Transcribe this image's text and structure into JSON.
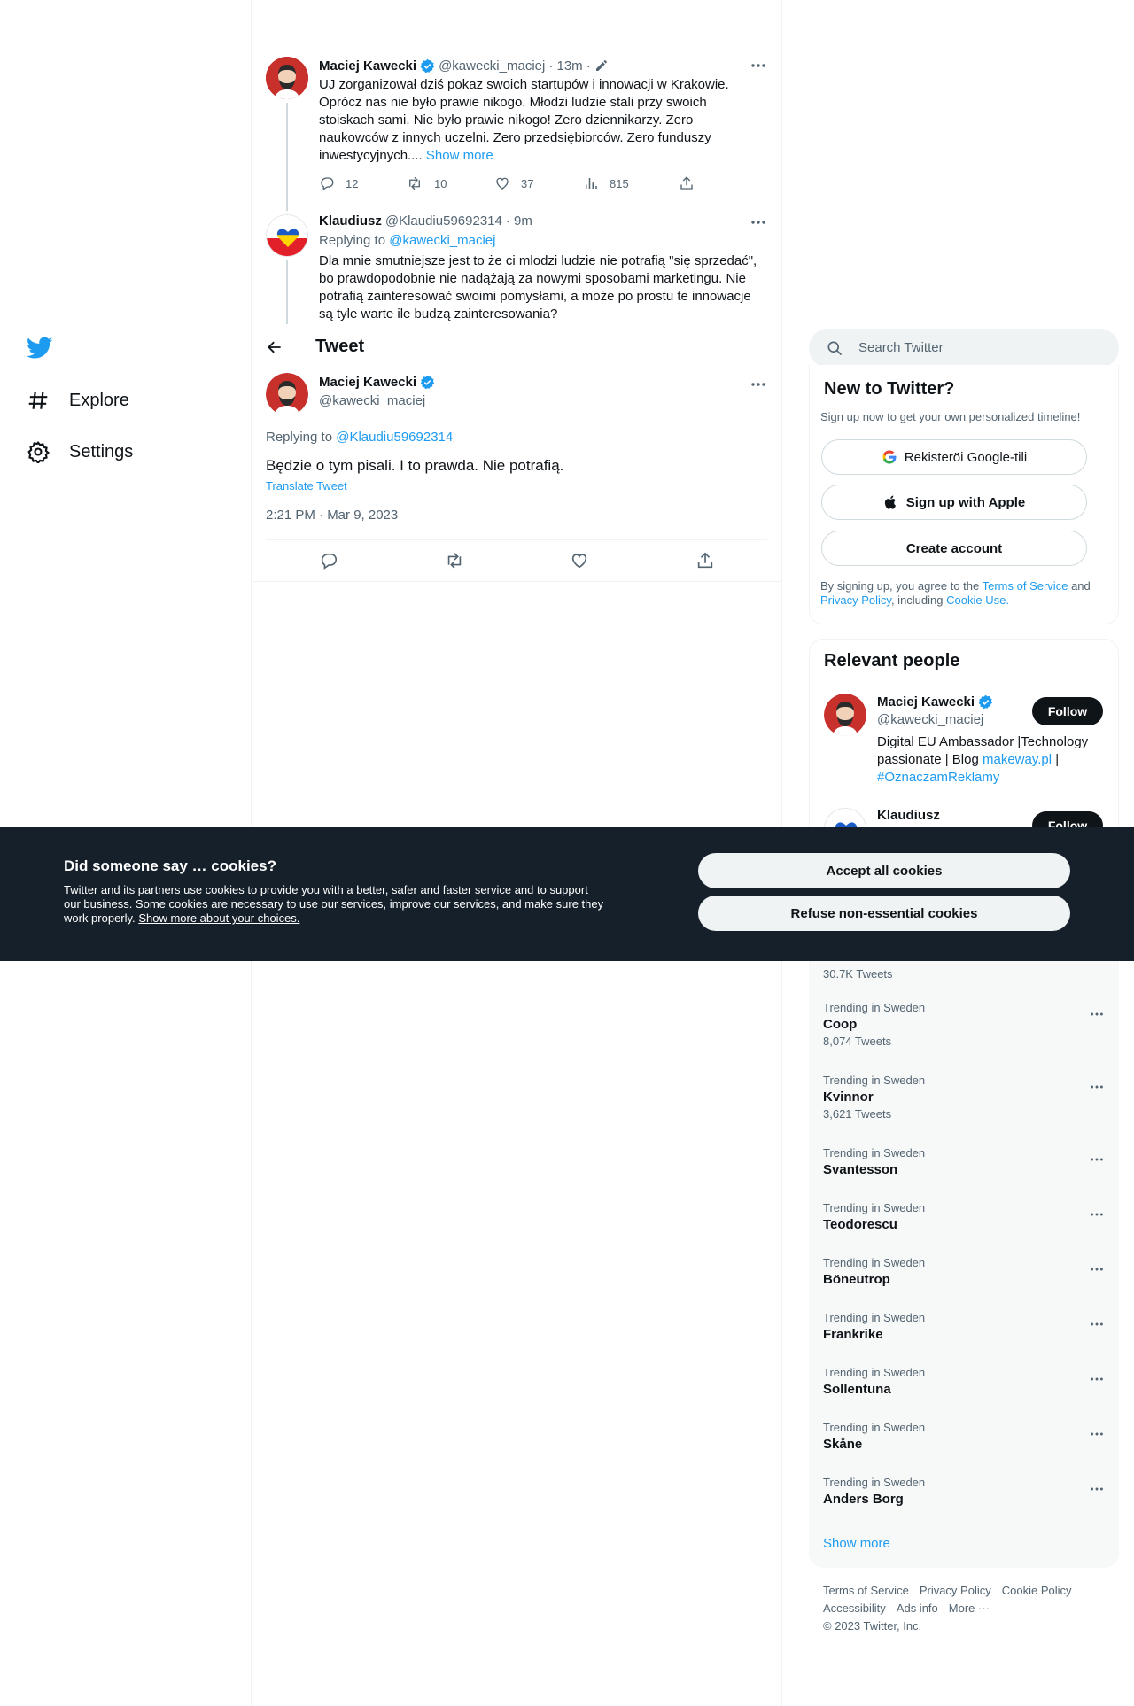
{
  "nav": {
    "items": [
      {
        "label": "Explore",
        "icon": "hashtag-icon"
      },
      {
        "label": "Settings",
        "icon": "gear-icon"
      }
    ]
  },
  "header": {
    "title": "Tweet"
  },
  "thread": {
    "tweet1": {
      "name": "Maciej Kawecki",
      "handle": "@kawecki_maciej",
      "time": "· 13m ·",
      "lines": [
        "UJ zorganizował dziś pokaz swoich startupów i innowacji w Krakowie.",
        "Oprócz nas nie było prawie nikogo. Młodzi ludzie stali przy swoich",
        "stoiskach sami. Nie było prawie nikogo! Zero dziennikarzy. Zero",
        "naukowców z innych uczelni. Zero przedsiębiorców. Zero funduszy",
        "inwestycyjnych...."
      ],
      "show_more": "Show more",
      "replies": "12",
      "retweets": "10",
      "likes": "37",
      "views": "815"
    },
    "tweet2": {
      "name": "Klaudiusz",
      "handle": "@Klaudiu59692314",
      "time": "· 9m",
      "replying_prefix": "Replying to",
      "replying_to": "@kawecki_maciej",
      "lines": [
        "Dla mnie smutniejsze jest to że ci mlodzi ludzie nie potrafią \"się sprzedać\",",
        "bo prawdopodobnie nie nadążają za nowymi sposobami marketingu. Nie",
        "potrafią zainteresować swoimi pomysłami, a może po prostu te innowacje",
        "są tyle warte ile budzą zainteresowania?"
      ]
    },
    "main": {
      "name": "Maciej Kawecki",
      "handle": "@kawecki_maciej",
      "replying_prefix": "Replying to",
      "replying_to": "@Klaudiu59692314",
      "text": "Będzie o tym pisali. I to prawda. Nie potrafią.",
      "translate": "Translate Tweet",
      "timestamp": "2:21 PM · Mar 9, 2023"
    }
  },
  "sidebar": {
    "search_placeholder": "Search Twitter",
    "new_title": "New to Twitter?",
    "new_sub": "Sign up now to get your own personalized timeline!",
    "google_label": "Rekisteröi Google-tili",
    "apple_label": "Sign up with Apple",
    "create_label": "Create account",
    "legal_1": "By signing up, you agree to the",
    "legal_tos": "Terms of Service",
    "legal_and": "and",
    "legal_privacy": "Privacy Policy",
    "legal_incl": ", including",
    "legal_cookie": "Cookie Use.",
    "relevant_title": "Relevant people",
    "person1": {
      "name": "Maciej Kawecki",
      "handle": "@kawecki_maciej",
      "bio1": "Digital EU Ambassador |Technology",
      "bio2a": "passionate | Blog",
      "bio2link": "makeway.pl",
      "bio2b": "|",
      "bio3": "#OznaczamReklamy",
      "follow": "Follow"
    },
    "person2": {
      "name": "Klaudiusz",
      "follow": "Follow"
    },
    "trend_partial_count": "30.7K Tweets",
    "trends": [
      {
        "context": "Trending in Sweden",
        "title": "Coop",
        "count": "8,074 Tweets"
      },
      {
        "context": "Trending in Sweden",
        "title": "Kvinnor",
        "count": "3,621 Tweets"
      },
      {
        "context": "Trending in Sweden",
        "title": "Svantesson",
        "count": ""
      },
      {
        "context": "Trending in Sweden",
        "title": "Teodorescu",
        "count": ""
      },
      {
        "context": "Trending in Sweden",
        "title": "Böneutrop",
        "count": ""
      },
      {
        "context": "Trending in Sweden",
        "title": "Frankrike",
        "count": ""
      },
      {
        "context": "Trending in Sweden",
        "title": "Sollentuna",
        "count": ""
      },
      {
        "context": "Trending in Sweden",
        "title": "Skåne",
        "count": ""
      },
      {
        "context": "Trending in Sweden",
        "title": "Anders Borg",
        "count": ""
      }
    ],
    "show_more": "Show more",
    "footer": {
      "tos": "Terms of Service",
      "privacy": "Privacy Policy",
      "cookie": "Cookie Policy",
      "access": "Accessibility",
      "ads": "Ads info",
      "more": "More ···",
      "copyright": "© 2023 Twitter, Inc."
    }
  },
  "cookie": {
    "title": "Did someone say … cookies?",
    "text1": "Twitter and its partners use cookies to provide you with a better, safer and faster service and to support",
    "text2": "our business. Some cookies are necessary to use our services, improve our services, and make sure they",
    "text3": "work properly.",
    "link": "Show more about your choices.",
    "accept": "Accept all cookies",
    "refuse": "Refuse non-essential cookies"
  },
  "colors": {
    "accent": "#1d9bf0",
    "banner": "#15202b",
    "text": "#0f1419",
    "secondary": "#536471"
  }
}
